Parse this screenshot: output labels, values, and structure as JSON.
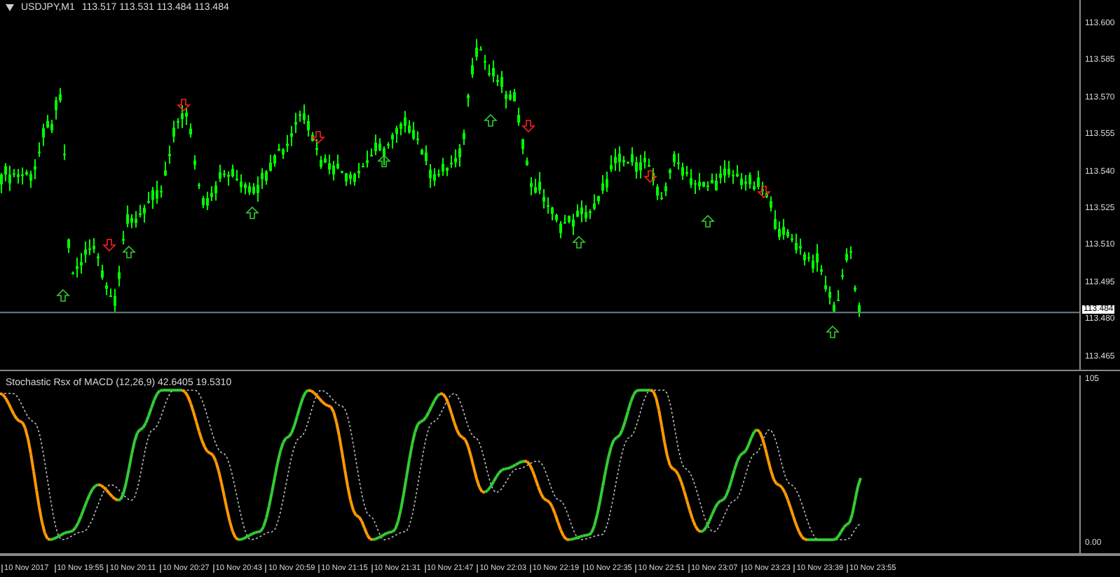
{
  "main_panel": {
    "symbol": "USDJPY,M1",
    "ohlc": "113.517 113.531 113.484 113.484",
    "price_ticks": [
      "113.600",
      "113.585",
      "113.570",
      "113.555",
      "113.540",
      "113.525",
      "113.510",
      "113.495",
      "113.480",
      "113.465"
    ],
    "current_price": "113.484"
  },
  "indicator_panel": {
    "title": "Stochastic Rsx of MACD  (12,26,9) 42.6405 19.5310",
    "ticks": [
      "105",
      "0.00"
    ]
  },
  "time_labels": [
    "10 Nov 2017",
    "10 Nov 19:55",
    "10 Nov 20:11",
    "10 Nov 20:27",
    "10 Nov 20:43",
    "10 Nov 20:59",
    "10 Nov 21:15",
    "10 Nov 21:31",
    "10 Nov 21:47",
    "10 Nov 22:03",
    "10 Nov 22:19",
    "10 Nov 22:35",
    "10 Nov 22:51",
    "10 Nov 23:07",
    "10 Nov 23:23",
    "10 Nov 23:39",
    "10 Nov 23:55"
  ]
}
